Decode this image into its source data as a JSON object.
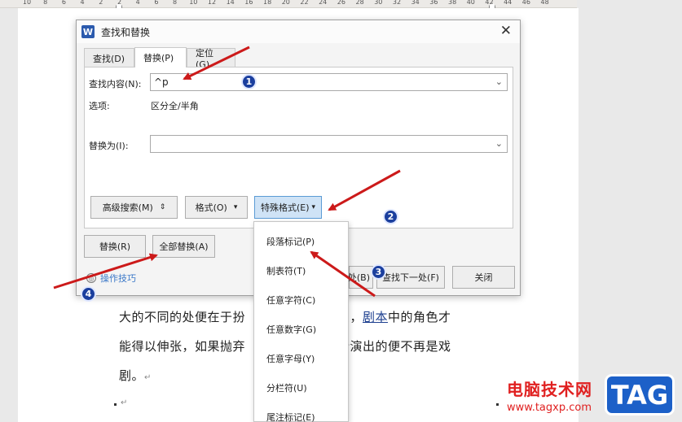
{
  "ruler": {
    "ticks": [
      "10",
      "8",
      "6",
      "4",
      "2",
      "2",
      "4",
      "6",
      "8",
      "10",
      "12",
      "14",
      "16",
      "18",
      "20",
      "22",
      "24",
      "26",
      "28",
      "30",
      "32",
      "34",
      "36",
      "38",
      "40",
      "42",
      "44",
      "46",
      "48"
    ]
  },
  "document": {
    "line1_a": "大的不同的处便在于扮",
    "line1_b": "的扮演，",
    "line1_link": "剧本",
    "line1_c": "中的角色才",
    "line2_a": "能得以伸张，如果抛弃",
    "line2_b": "那么所演出的便不再是戏",
    "line3": "剧。",
    "para_mark": "↵"
  },
  "dialog": {
    "title": "查找和替换",
    "app_icon_letter": "W",
    "close_glyph": "✕",
    "tabs": [
      {
        "label": "查找(D)"
      },
      {
        "label": "替换(P)"
      },
      {
        "label": "定位(G)"
      }
    ],
    "find_label": "查找内容(N):",
    "find_value": "^p",
    "options_label": "选项:",
    "options_value": "区分全/半角",
    "replace_label": "替换为(I):",
    "replace_value": "",
    "dropdown_caret": "⌄",
    "advanced_search": "高级搜索(M)",
    "advanced_glyph": "⇕",
    "format": "格式(O)",
    "special_format": "特殊格式(E)",
    "drop_glyph": "▾",
    "replace_btn": "替换(R)",
    "replace_all_btn": "全部替换(A)",
    "find_prev_btn": "处(B)",
    "find_next_btn": "查找下一处(F)",
    "close_btn": "关闭",
    "tips_icon": "◎",
    "tips": "操作技巧"
  },
  "menu": {
    "items": [
      "段落标记(P)",
      "制表符(T)",
      "任意字符(C)",
      "任意数字(G)",
      "任意字母(Y)",
      "分栏符(U)",
      "尾注标记(E)"
    ]
  },
  "annotations": {
    "badges": [
      "1",
      "2",
      "3",
      "4"
    ],
    "arrow_color": "#cc1a1a"
  },
  "watermark": {
    "text": "电脑技术网",
    "url": "www.tagxp.com",
    "logo": "TAG"
  },
  "colors": {
    "accent_blue": "#1c60c8",
    "button_hot": "#cfe3f6",
    "link": "#1d3f8f"
  }
}
